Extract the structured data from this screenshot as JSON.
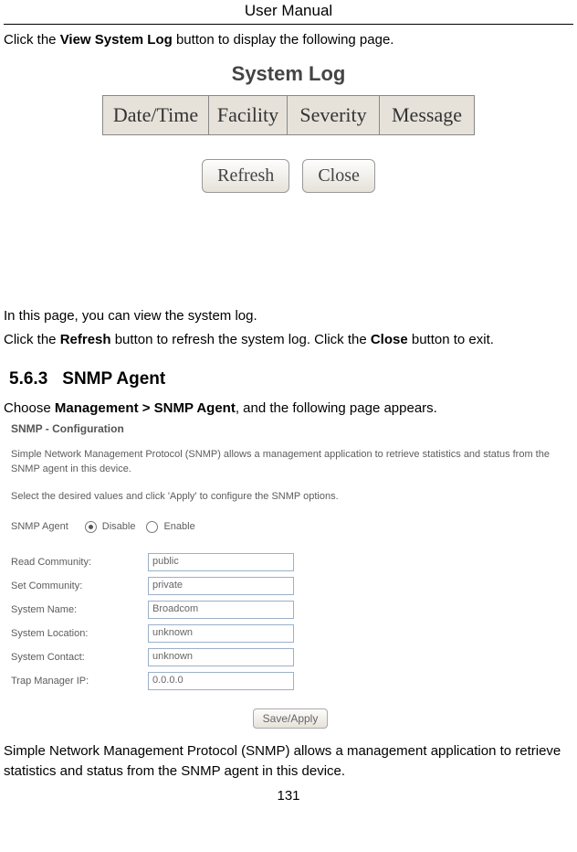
{
  "header": "User Manual",
  "intro1_a": "Click the ",
  "intro1_b": "View System Log",
  "intro1_c": " button to display the following page.",
  "syslog": {
    "title": "System Log",
    "cols": {
      "date": "Date/Time",
      "facility": "Facility",
      "severity": "Severity",
      "message": "Message"
    },
    "refresh": "Refresh",
    "close": "Close"
  },
  "after1": "In this page, you can view the system log.",
  "after2_a": "Click the ",
  "after2_b": "Refresh",
  "after2_c": " button to refresh the system log. Click the ",
  "after2_d": "Close",
  "after2_e": " button to exit.",
  "section": {
    "num": "5.6.3",
    "title": "SNMP Agent"
  },
  "choose_a": "Choose ",
  "choose_b": "Management > SNMP Agent",
  "choose_c": ", and the following page appears.",
  "snmp": {
    "title": "SNMP - Configuration",
    "desc1": "Simple Network Management Protocol (SNMP) allows a management application to retrieve statistics and status from the SNMP agent in this device.",
    "desc2": "Select the desired values and click 'Apply' to configure the SNMP options.",
    "agent_label": "SNMP Agent",
    "disable": "Disable",
    "enable": "Enable",
    "fields": {
      "read_l": "Read Community:",
      "read_v": "public",
      "set_l": "Set Community:",
      "set_v": "private",
      "sysname_l": "System Name:",
      "sysname_v": "Broadcom",
      "sysloc_l": "System Location:",
      "sysloc_v": "unknown",
      "syscon_l": "System Contact:",
      "syscon_v": "unknown",
      "trap_l": "Trap Manager IP:",
      "trap_v": "0.0.0.0"
    },
    "apply": "Save/Apply"
  },
  "closing": "Simple Network Management Protocol (SNMP) allows a management application to retrieve statistics and status from the SNMP agent in this device.",
  "page_num": "131"
}
